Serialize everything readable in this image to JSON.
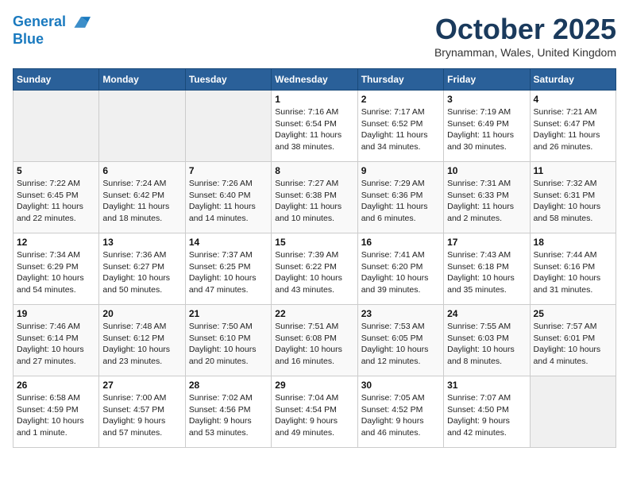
{
  "header": {
    "logo_line1": "General",
    "logo_line2": "Blue",
    "month_title": "October 2025",
    "subtitle": "Brynamman, Wales, United Kingdom"
  },
  "days_of_week": [
    "Sunday",
    "Monday",
    "Tuesday",
    "Wednesday",
    "Thursday",
    "Friday",
    "Saturday"
  ],
  "weeks": [
    [
      {
        "day": "",
        "info": ""
      },
      {
        "day": "",
        "info": ""
      },
      {
        "day": "",
        "info": ""
      },
      {
        "day": "1",
        "info": "Sunrise: 7:16 AM\nSunset: 6:54 PM\nDaylight: 11 hours\nand 38 minutes."
      },
      {
        "day": "2",
        "info": "Sunrise: 7:17 AM\nSunset: 6:52 PM\nDaylight: 11 hours\nand 34 minutes."
      },
      {
        "day": "3",
        "info": "Sunrise: 7:19 AM\nSunset: 6:49 PM\nDaylight: 11 hours\nand 30 minutes."
      },
      {
        "day": "4",
        "info": "Sunrise: 7:21 AM\nSunset: 6:47 PM\nDaylight: 11 hours\nand 26 minutes."
      }
    ],
    [
      {
        "day": "5",
        "info": "Sunrise: 7:22 AM\nSunset: 6:45 PM\nDaylight: 11 hours\nand 22 minutes."
      },
      {
        "day": "6",
        "info": "Sunrise: 7:24 AM\nSunset: 6:42 PM\nDaylight: 11 hours\nand 18 minutes."
      },
      {
        "day": "7",
        "info": "Sunrise: 7:26 AM\nSunset: 6:40 PM\nDaylight: 11 hours\nand 14 minutes."
      },
      {
        "day": "8",
        "info": "Sunrise: 7:27 AM\nSunset: 6:38 PM\nDaylight: 11 hours\nand 10 minutes."
      },
      {
        "day": "9",
        "info": "Sunrise: 7:29 AM\nSunset: 6:36 PM\nDaylight: 11 hours\nand 6 minutes."
      },
      {
        "day": "10",
        "info": "Sunrise: 7:31 AM\nSunset: 6:33 PM\nDaylight: 11 hours\nand 2 minutes."
      },
      {
        "day": "11",
        "info": "Sunrise: 7:32 AM\nSunset: 6:31 PM\nDaylight: 10 hours\nand 58 minutes."
      }
    ],
    [
      {
        "day": "12",
        "info": "Sunrise: 7:34 AM\nSunset: 6:29 PM\nDaylight: 10 hours\nand 54 minutes."
      },
      {
        "day": "13",
        "info": "Sunrise: 7:36 AM\nSunset: 6:27 PM\nDaylight: 10 hours\nand 50 minutes."
      },
      {
        "day": "14",
        "info": "Sunrise: 7:37 AM\nSunset: 6:25 PM\nDaylight: 10 hours\nand 47 minutes."
      },
      {
        "day": "15",
        "info": "Sunrise: 7:39 AM\nSunset: 6:22 PM\nDaylight: 10 hours\nand 43 minutes."
      },
      {
        "day": "16",
        "info": "Sunrise: 7:41 AM\nSunset: 6:20 PM\nDaylight: 10 hours\nand 39 minutes."
      },
      {
        "day": "17",
        "info": "Sunrise: 7:43 AM\nSunset: 6:18 PM\nDaylight: 10 hours\nand 35 minutes."
      },
      {
        "day": "18",
        "info": "Sunrise: 7:44 AM\nSunset: 6:16 PM\nDaylight: 10 hours\nand 31 minutes."
      }
    ],
    [
      {
        "day": "19",
        "info": "Sunrise: 7:46 AM\nSunset: 6:14 PM\nDaylight: 10 hours\nand 27 minutes."
      },
      {
        "day": "20",
        "info": "Sunrise: 7:48 AM\nSunset: 6:12 PM\nDaylight: 10 hours\nand 23 minutes."
      },
      {
        "day": "21",
        "info": "Sunrise: 7:50 AM\nSunset: 6:10 PM\nDaylight: 10 hours\nand 20 minutes."
      },
      {
        "day": "22",
        "info": "Sunrise: 7:51 AM\nSunset: 6:08 PM\nDaylight: 10 hours\nand 16 minutes."
      },
      {
        "day": "23",
        "info": "Sunrise: 7:53 AM\nSunset: 6:05 PM\nDaylight: 10 hours\nand 12 minutes."
      },
      {
        "day": "24",
        "info": "Sunrise: 7:55 AM\nSunset: 6:03 PM\nDaylight: 10 hours\nand 8 minutes."
      },
      {
        "day": "25",
        "info": "Sunrise: 7:57 AM\nSunset: 6:01 PM\nDaylight: 10 hours\nand 4 minutes."
      }
    ],
    [
      {
        "day": "26",
        "info": "Sunrise: 6:58 AM\nSunset: 4:59 PM\nDaylight: 10 hours\nand 1 minute."
      },
      {
        "day": "27",
        "info": "Sunrise: 7:00 AM\nSunset: 4:57 PM\nDaylight: 9 hours\nand 57 minutes."
      },
      {
        "day": "28",
        "info": "Sunrise: 7:02 AM\nSunset: 4:56 PM\nDaylight: 9 hours\nand 53 minutes."
      },
      {
        "day": "29",
        "info": "Sunrise: 7:04 AM\nSunset: 4:54 PM\nDaylight: 9 hours\nand 49 minutes."
      },
      {
        "day": "30",
        "info": "Sunrise: 7:05 AM\nSunset: 4:52 PM\nDaylight: 9 hours\nand 46 minutes."
      },
      {
        "day": "31",
        "info": "Sunrise: 7:07 AM\nSunset: 4:50 PM\nDaylight: 9 hours\nand 42 minutes."
      },
      {
        "day": "",
        "info": ""
      }
    ]
  ]
}
